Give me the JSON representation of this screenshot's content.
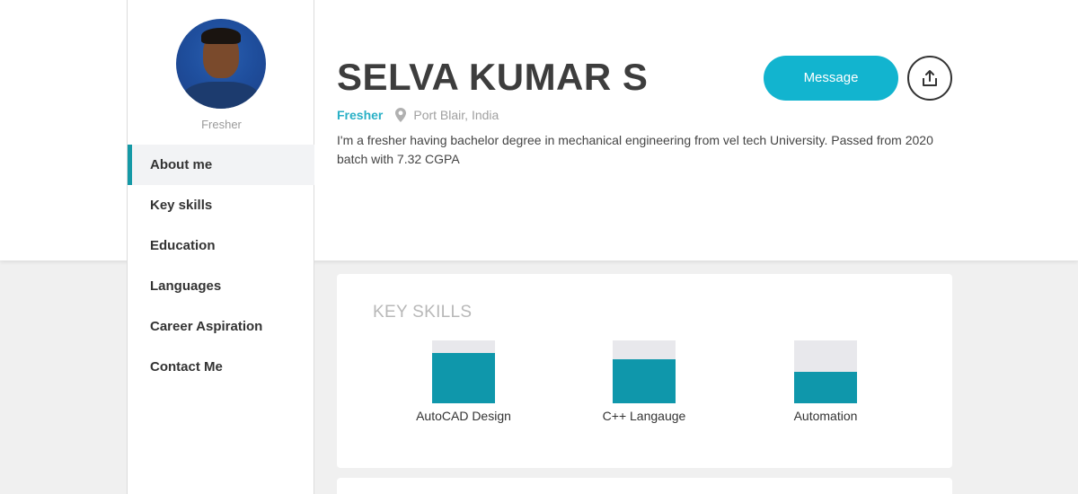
{
  "profile": {
    "name": "SELVA KUMAR S",
    "status": "Fresher",
    "location": "Port Blair, India",
    "bio": "I'm a fresher having bachelor degree in mechanical engineering from vel tech University. Passed from 2020 batch with 7.32 CGPA",
    "avatar_caption": "Fresher"
  },
  "actions": {
    "message_label": "Message",
    "share_icon": "share-icon"
  },
  "sidebar": {
    "items": [
      {
        "label": "About me",
        "active": true
      },
      {
        "label": "Key skills",
        "active": false
      },
      {
        "label": "Education",
        "active": false
      },
      {
        "label": "Languages",
        "active": false
      },
      {
        "label": "Career Aspiration",
        "active": false
      },
      {
        "label": "Contact Me",
        "active": false
      }
    ]
  },
  "skills": {
    "title": "KEY SKILLS",
    "items": [
      {
        "name": "AutoCAD Design",
        "level": 0.8
      },
      {
        "name": "C++ Langauge",
        "level": 0.7
      },
      {
        "name": "Automation",
        "level": 0.5
      }
    ]
  },
  "colors": {
    "accent": "#12b4cf",
    "skill_fill": "#0f97ab",
    "active_indicator": "#1599a6",
    "status_text": "#29b0c6"
  }
}
